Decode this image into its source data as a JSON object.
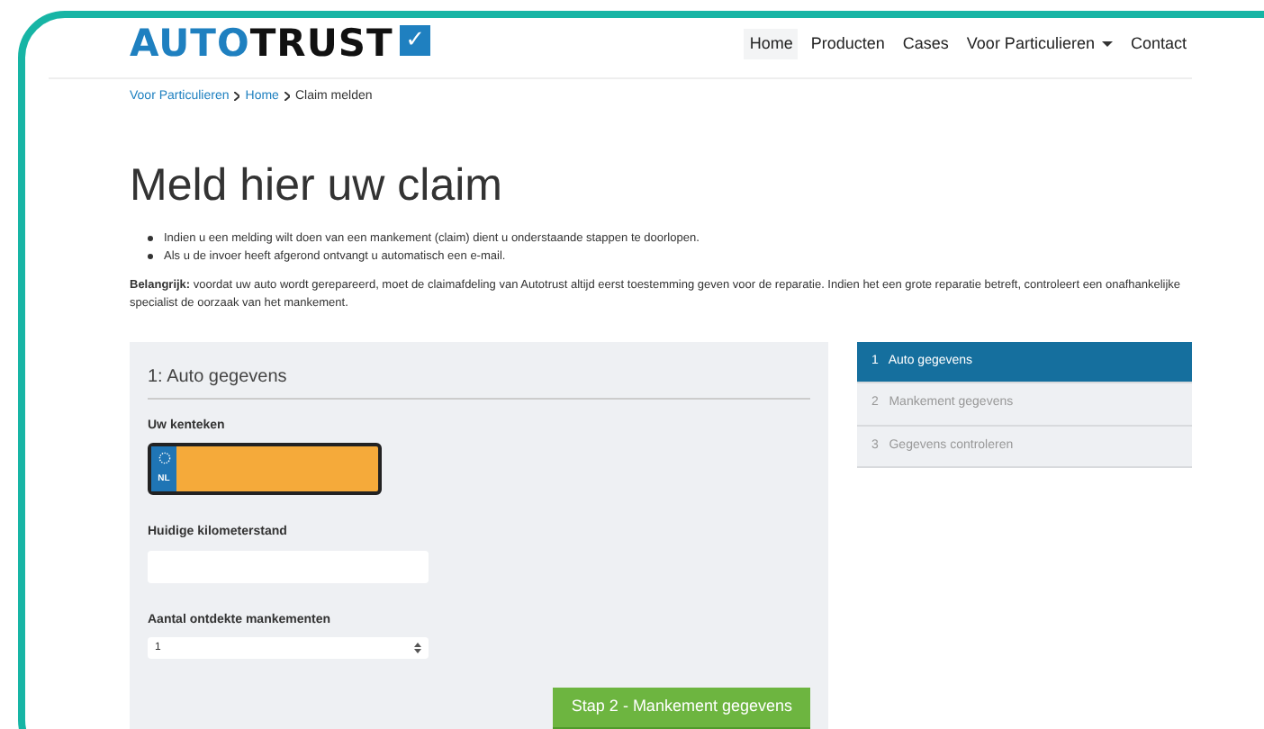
{
  "logo": {
    "text_a": "AUTO",
    "text_b": "TRUST",
    "check": "✓"
  },
  "nav": [
    {
      "label": "Home",
      "selected": true,
      "dropdown": false
    },
    {
      "label": "Producten",
      "selected": false,
      "dropdown": false
    },
    {
      "label": "Cases",
      "selected": false,
      "dropdown": false
    },
    {
      "label": "Voor Particulieren",
      "selected": false,
      "dropdown": true
    },
    {
      "label": "Contact",
      "selected": false,
      "dropdown": false
    }
  ],
  "breadcrumb": [
    {
      "label": "Voor Particulieren",
      "link": true
    },
    {
      "label": "Home",
      "link": true
    },
    {
      "label": "Claim melden",
      "link": false
    }
  ],
  "heading": "Meld hier uw claim",
  "bullets": [
    "Indien u een melding wilt doen van een mankement (claim) dient u onderstaande stappen te doorlopen.",
    "Als u de invoer heeft afgerond ontvangt u automatisch een e-mail."
  ],
  "notice": "**Belangrijk:** voordat uw auto wordt gerepareerd, moet de claimafdeling van Autotrust altijd eerst toestemming geven voor de reparatie. Indien het een grote reparatie betreft, controleert een onafhankelijke specialist de oorzaak van het mankement.",
  "form": {
    "title": "1: Auto gegevens",
    "plate": {
      "label": "Uw kenteken",
      "country": "NL"
    },
    "km": {
      "label": "Huidige kilometerstand"
    },
    "count": {
      "label": "Aantal ontdekte mankementen",
      "value": "1"
    },
    "button": "Stap 2 - Mankement gegevens"
  },
  "steps": [
    {
      "number": "1",
      "label": "Auto gegevens",
      "selected": true
    },
    {
      "number": "2",
      "label": "Mankement gegevens",
      "selected": false
    },
    {
      "number": "3",
      "label": "Gegevens controleren",
      "selected": false
    }
  ]
}
